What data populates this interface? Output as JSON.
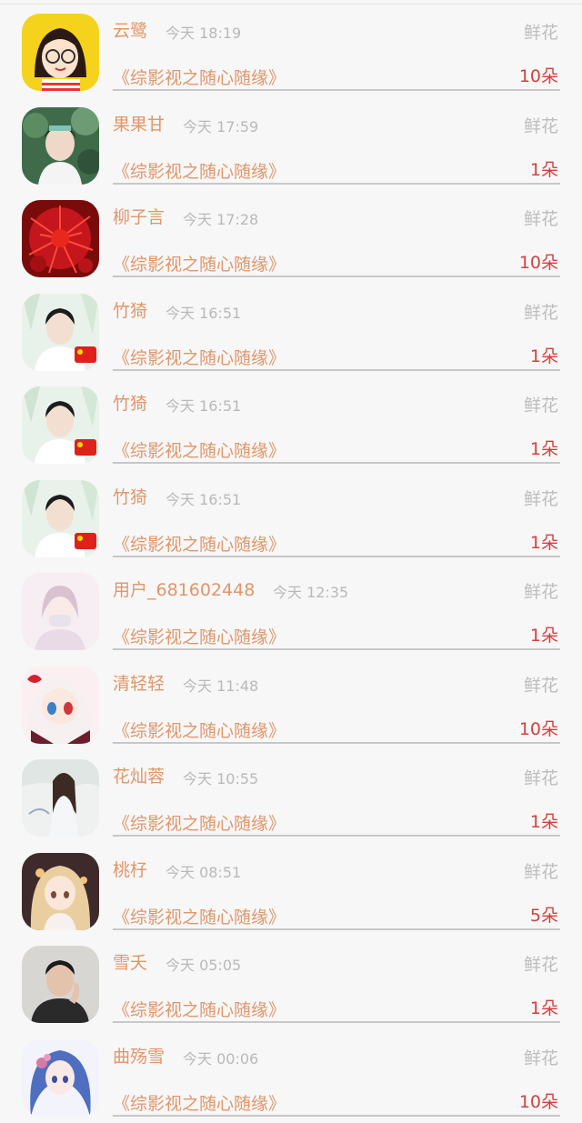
{
  "records": [
    {
      "name": "云鹭",
      "time": "今天 18:19",
      "type": "鲜花",
      "book": "《综影视之随心随缘》",
      "count": "10朵",
      "avatar": "cartoon-girl-glasses-avatar"
    },
    {
      "name": "果果甘",
      "time": "今天 17:59",
      "type": "鲜花",
      "book": "《综影视之随心随缘》",
      "count": "1朵",
      "avatar": "young-man-photo-avatar"
    },
    {
      "name": "柳子言",
      "time": "今天 17:28",
      "type": "鲜花",
      "book": "《综影视之随心随缘》",
      "count": "10朵",
      "avatar": "red-spider-lily-avatar"
    },
    {
      "name": "竹猗",
      "time": "今天 16:51",
      "type": "鲜花",
      "book": "《综影视之随心随缘》",
      "count": "1朵",
      "avatar": "young-man-flag-avatar"
    },
    {
      "name": "竹猗",
      "time": "今天 16:51",
      "type": "鲜花",
      "book": "《综影视之随心随缘》",
      "count": "1朵",
      "avatar": "young-man-flag-avatar"
    },
    {
      "name": "竹猗",
      "time": "今天 16:51",
      "type": "鲜花",
      "book": "《综影视之随心随缘》",
      "count": "1朵",
      "avatar": "young-man-flag-avatar"
    },
    {
      "name": "用户_681602448",
      "time": "今天 12:35",
      "type": "鲜花",
      "book": "《综影视之随心随缘》",
      "count": "1朵",
      "avatar": "masked-figure-avatar"
    },
    {
      "name": "清轻轻",
      "time": "今天 11:48",
      "type": "鲜花",
      "book": "《综影视之随心随缘》",
      "count": "10朵",
      "avatar": "anime-girl-avatar"
    },
    {
      "name": "花灿蓉",
      "time": "今天 10:55",
      "type": "鲜花",
      "book": "《综影视之随心随缘》",
      "count": "1朵",
      "avatar": "illustrated-girl-avatar"
    },
    {
      "name": "桃杍",
      "time": "今天 08:51",
      "type": "鲜花",
      "book": "《综影视之随心随缘》",
      "count": "5朵",
      "avatar": "blonde-anime-girl-avatar"
    },
    {
      "name": "雪夭",
      "time": "今天 05:05",
      "type": "鲜花",
      "book": "《综影视之随心随缘》",
      "count": "1朵",
      "avatar": "man-portrait-avatar"
    },
    {
      "name": "曲殇雪",
      "time": "今天 00:06",
      "type": "鲜花",
      "book": "《综影视之随心随缘》",
      "count": "10朵",
      "avatar": "blue-hair-girl-avatar"
    }
  ],
  "colors": {
    "name": "#e0966a",
    "count": "#d3423f",
    "muted": "#bdbdbd",
    "background": "#f7f7f7"
  }
}
